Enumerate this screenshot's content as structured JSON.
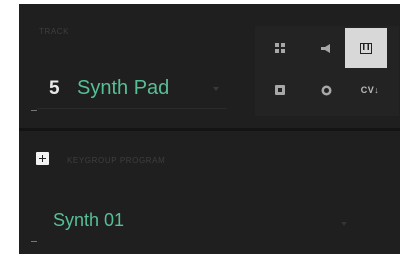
{
  "track": {
    "label": "TRACK",
    "number": "5",
    "name": "Synth Pad"
  },
  "mode_buttons": [
    {
      "name": "grid-icon",
      "label": ""
    },
    {
      "name": "speaker-icon",
      "label": ""
    },
    {
      "name": "keys-icon",
      "label": "",
      "active": true
    },
    {
      "name": "square-icon",
      "label": ""
    },
    {
      "name": "circle-icon",
      "label": ""
    },
    {
      "name": "cv-button",
      "label": "CV↓"
    }
  ],
  "program": {
    "label": "KEYGROUP PROGRAM",
    "name": "Synth 01"
  },
  "colors": {
    "accent": "#57bf96",
    "panel": "#1f1f1f",
    "active_button": "#d8d8d8"
  }
}
